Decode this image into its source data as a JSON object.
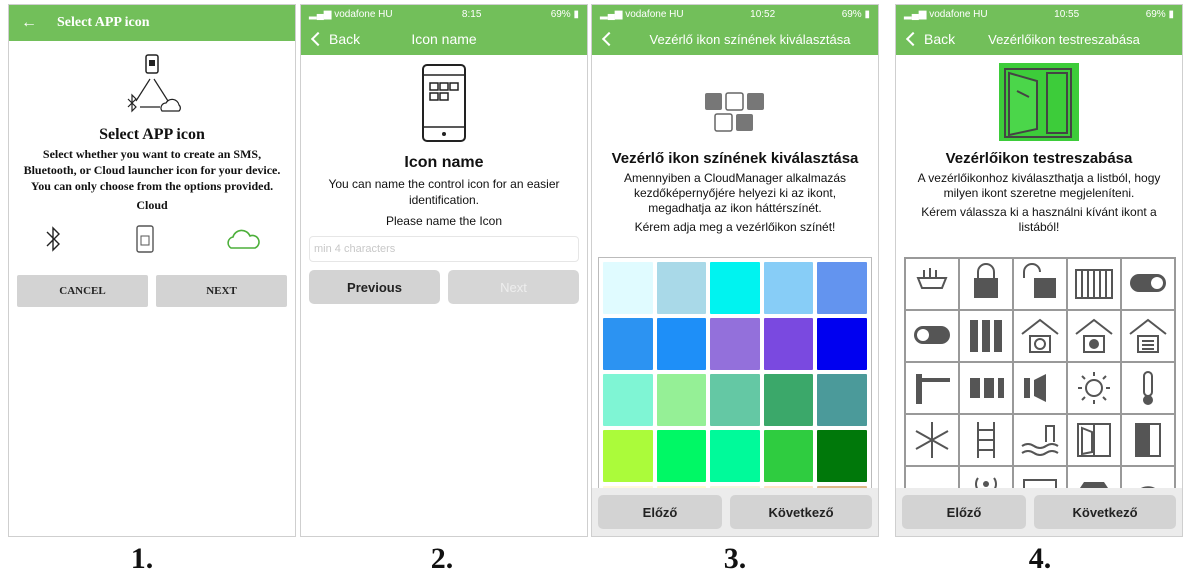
{
  "screens": [
    {
      "nav_title": "Select APP icon",
      "heading": "Select APP icon",
      "description": "Select whether you want to create an SMS, Bluetooth, or Cloud launcher icon for your device. You can only choose from the options provided.",
      "selected_option": "Cloud",
      "cancel_label": "CANCEL",
      "next_label": "NEXT",
      "step_label": "1."
    },
    {
      "status": {
        "carrier": "vodafone HU",
        "time": "8:15",
        "battery": "69%"
      },
      "back_label": "Back",
      "nav_title": "Icon name",
      "heading": "Icon name",
      "description": "You can name the control icon for an easier identification.",
      "prompt": "Please name the Icon",
      "input_placeholder": "min 4 characters",
      "previous_label": "Previous",
      "next_label": "Next",
      "step_label": "2."
    },
    {
      "status": {
        "carrier": "vodafone HU",
        "time": "10:52",
        "battery": "69%"
      },
      "nav_title": "Vezérlő ikon színének kiválasztása",
      "heading": "Vezérlő ikon színének kiválasztása",
      "description": "Amennyiben a CloudManager alkalmazás kezdőképernyőjére helyezi ki az ikont, megadhatja az ikon háttérszínét.",
      "prompt": "Kérem adja meg a vezérlőikon színét!",
      "colors": [
        "#e0fbff",
        "#a9d9e8",
        "#00f3f0",
        "#87cdf7",
        "#6394ef",
        "#2c93f2",
        "#1e8ff8",
        "#9370db",
        "#7a49e0",
        "#0000f0",
        "#7ff5d4",
        "#95f096",
        "#64c8a4",
        "#3ba86a",
        "#4b9a9a",
        "#abfb3a",
        "#00f865",
        "#00fa9a",
        "#2fcc40",
        "#00780a",
        "#fff8dc",
        "#fffacd",
        "#f5f5dc",
        "#ffe4c4",
        "#deb887"
      ],
      "previous_label": "Előző",
      "next_label": "Következő",
      "step_label": "3."
    },
    {
      "status": {
        "carrier": "vodafone HU",
        "time": "10:55",
        "battery": "69%"
      },
      "back_label": "Back",
      "nav_title": "Vezérlőikon testreszabása",
      "heading": "Vezérlőikon testreszabása",
      "description": "A vezérlőikonhoz kiválaszthatja a listból, hogy milyen ikont szeretne megjeleníteni.",
      "prompt": "Kérem válassza ki a használni kívánt ikont a listából!",
      "icons": [
        "feeder-icon",
        "padlock-closed-icon",
        "padlock-open-icon",
        "gate-icon",
        "toggle-on-icon",
        "toggle-off-icon",
        "server-rack-icon",
        "house-check-icon",
        "house-x-icon",
        "house-doc-icon",
        "barrier-icon",
        "sliding-gate-icon",
        "speaker-icon",
        "bulb-icon",
        "thermometer-icon",
        "snowflake-icon",
        "ladder-icon",
        "pool-icon",
        "double-door-icon",
        "door-icon",
        "shutter-icon",
        "wireless-icon",
        "heater-icon",
        "awning-icon",
        "arc-icon"
      ],
      "previous_label": "Előző",
      "next_label": "Következő",
      "step_label": "4."
    }
  ]
}
